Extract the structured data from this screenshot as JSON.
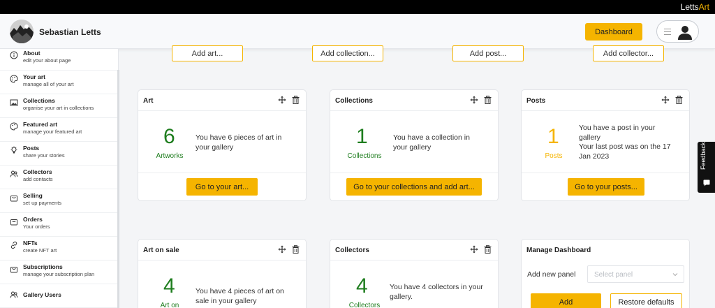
{
  "brand": {
    "name_part1": "Letts",
    "name_part2": "Art"
  },
  "header": {
    "username": "Sebastian Letts",
    "dashboard_label": "Dashboard"
  },
  "sidebar": {
    "items": [
      {
        "title": "About",
        "subtitle": "edit your about page",
        "icon": "info-icon"
      },
      {
        "title": "Your art",
        "subtitle": "manage all of your art",
        "icon": "palette-icon"
      },
      {
        "title": "Collections",
        "subtitle": "organise your art in collections",
        "icon": "image-icon"
      },
      {
        "title": "Featured art",
        "subtitle": "manage your featured art",
        "icon": "palette-icon"
      },
      {
        "title": "Posts",
        "subtitle": "share your stories",
        "icon": "lightbulb-icon"
      },
      {
        "title": "Collectors",
        "subtitle": "add contacts",
        "icon": "users-icon"
      },
      {
        "title": "Selling",
        "subtitle": "set up payments",
        "icon": "bag-icon"
      },
      {
        "title": "Orders",
        "subtitle": "Your orders",
        "icon": "bag-icon"
      },
      {
        "title": "NFTs",
        "subtitle": "create NFT art",
        "icon": "link-icon"
      },
      {
        "title": "Subscriptions",
        "subtitle": "manage your subscription plan",
        "icon": "bag-icon"
      },
      {
        "title": "Gallery Users",
        "subtitle": "",
        "icon": "users-icon"
      }
    ]
  },
  "add_buttons": [
    "Add art...",
    "Add collection...",
    "Add post...",
    "Add collector..."
  ],
  "panels": {
    "art": {
      "title": "Art",
      "number": "6",
      "label": "Artworks",
      "text": "You have 6 pieces of art in your gallery",
      "cta": "Go to your art..."
    },
    "collections": {
      "title": "Collections",
      "number": "1",
      "label": "Collections",
      "text": "You have a collection in your gallery",
      "cta": "Go to your collections and add art..."
    },
    "posts": {
      "title": "Posts",
      "number": "1",
      "label": "Posts",
      "text_line1": "You have a post in your gallery",
      "text_line2": "Your last post was on the 17 Jan 2023",
      "cta": "Go to your posts..."
    },
    "art_on_sale": {
      "title": "Art on sale",
      "number": "4",
      "label": "Art on",
      "text": "You have 4 pieces of art on sale in your gallery"
    },
    "collectors": {
      "title": "Collectors",
      "number": "4",
      "label": "Collectors",
      "text": "You have 4 collectors in your gallery."
    },
    "manage": {
      "title": "Manage Dashboard",
      "add_label": "Add new panel",
      "select_placeholder": "Select panel",
      "add_button": "Add",
      "restore_button": "Restore defaults"
    }
  },
  "feedback": {
    "label": "Feedback"
  },
  "colors": {
    "accent": "#f5b400",
    "green": "#1e7d1e"
  }
}
